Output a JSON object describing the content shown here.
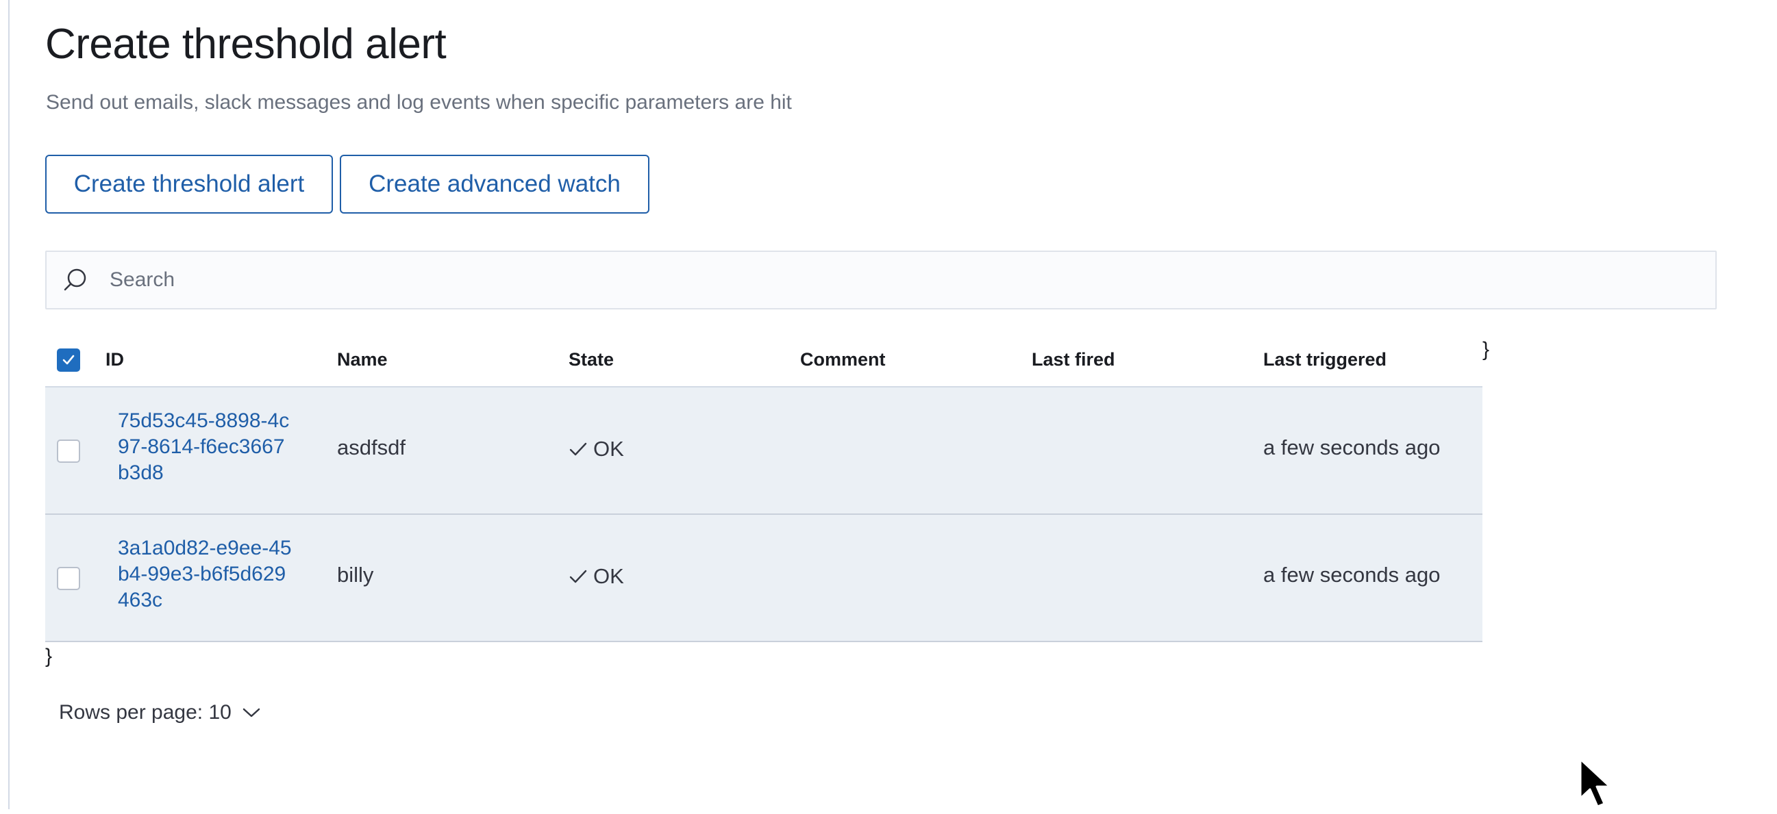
{
  "header": {
    "title": "Create threshold alert",
    "subtitle": "Send out emails, slack messages and log events when specific parameters are hit"
  },
  "actions": {
    "create_threshold_label": "Create threshold alert",
    "create_advanced_label": "Create advanced watch"
  },
  "search": {
    "placeholder": "Search",
    "value": ""
  },
  "table": {
    "header_checkbox_checked": true,
    "columns": {
      "id": "ID",
      "name": "Name",
      "state": "State",
      "comment": "Comment",
      "last_fired": "Last fired",
      "last_triggered": "Last triggered"
    },
    "rows": [
      {
        "checked": false,
        "id": "75d53c45-8898-4c97-8614-f6ec3667b3d8",
        "name": "asdfsdf",
        "state": "OK",
        "comment": "",
        "last_fired": "",
        "last_triggered": "a few seconds ago"
      },
      {
        "checked": false,
        "id": "3a1a0d82-e9ee-45b4-99e3-b6f5d629463c",
        "name": "billy",
        "state": "OK",
        "comment": "",
        "last_fired": "",
        "last_triggered": "a few seconds ago"
      }
    ]
  },
  "stray_text": {
    "brace_right": "}",
    "brace_left": "}"
  },
  "pagination": {
    "rows_per_page_label": "Rows per page: 10"
  },
  "colors": {
    "primary": "#1f5ea8",
    "checkbox_checked": "#1f6dbf",
    "row_background": "#ebf0f5"
  }
}
